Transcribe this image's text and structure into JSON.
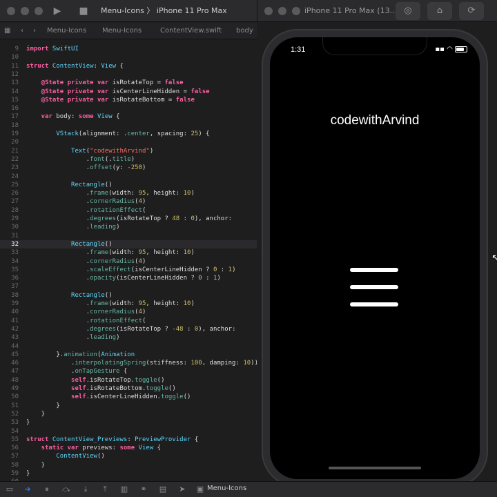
{
  "xcode_toolbar": {
    "scheme_target": "Menu-Icons",
    "scheme_device": "iPhone 11 Pro Max",
    "run_icon": "play-icon",
    "stop_icon": "stop-icon"
  },
  "simulator_toolbar": {
    "title": "iPhone 11 Pro Max (13....",
    "tools": [
      "screenshot-icon",
      "home-icon",
      "rotate-icon"
    ]
  },
  "jumpbar": {
    "crumbs": [
      "Menu-Icons",
      "Menu-Icons",
      "ContentView.swift",
      "body"
    ]
  },
  "editor": {
    "current_line": 32,
    "lines": [
      {
        "n": 9
      },
      {
        "n": 10
      },
      {
        "n": 11
      },
      {
        "n": 12
      },
      {
        "n": 13
      },
      {
        "n": 14
      },
      {
        "n": 15
      },
      {
        "n": 16
      },
      {
        "n": 17
      },
      {
        "n": 18
      },
      {
        "n": 19
      },
      {
        "n": 20
      },
      {
        "n": 21
      },
      {
        "n": 22
      },
      {
        "n": 23
      },
      {
        "n": 24
      },
      {
        "n": 25
      },
      {
        "n": 26
      },
      {
        "n": 27
      },
      {
        "n": 28
      },
      {
        "n": 29
      },
      {
        "n": 30
      },
      {
        "n": 31
      },
      {
        "n": 32
      },
      {
        "n": 33
      },
      {
        "n": 34
      },
      {
        "n": 35
      },
      {
        "n": 36
      },
      {
        "n": 37
      },
      {
        "n": 38
      },
      {
        "n": 39
      },
      {
        "n": 40
      },
      {
        "n": 41
      },
      {
        "n": 42
      },
      {
        "n": 43
      },
      {
        "n": 44
      },
      {
        "n": 45
      },
      {
        "n": 46
      },
      {
        "n": 47
      },
      {
        "n": 48
      },
      {
        "n": 49
      },
      {
        "n": 50
      },
      {
        "n": 51
      },
      {
        "n": 52
      },
      {
        "n": 53
      },
      {
        "n": 54
      },
      {
        "n": 55
      },
      {
        "n": 56
      },
      {
        "n": 57
      },
      {
        "n": 58
      },
      {
        "n": 59
      },
      {
        "n": 60
      }
    ],
    "code": {
      "l9_kw": "import",
      "l9_ty": " SwiftUI",
      "l11_kw": "struct",
      "l11_ty": " ContentView",
      "l11_pl": ": ",
      "l11_ty2": "View",
      "l11_pl2": " {",
      "l13_kw": "    @State private var",
      "l13_pl": " isRotateTop = ",
      "l13_kw2": "false",
      "l14_kw": "    @State private var",
      "l14_pl": " isCenterLineHidden = ",
      "l14_kw2": "false",
      "l15_kw": "    @State private var",
      "l15_pl": " isRotateBottom = ",
      "l15_kw2": "false",
      "l17_kw": "    var",
      "l17_pl": " body: ",
      "l17_kw2": "some",
      "l17_ty": " View",
      "l17_pl2": " {",
      "l19_ty": "        VStack",
      "l19_pl": "(alignment: .",
      "l19_fn": "center",
      "l19_pl2": ", spacing: ",
      "l19_nu": "25",
      "l19_pl3": ") {",
      "l21_ty": "            Text",
      "l21_pl": "(",
      "l21_st": "\"codewithArvind\"",
      "l21_pl2": ")",
      "l22_pl": "                .",
      "l22_fn": "font",
      "l22_pl2": "(.",
      "l22_fn2": "title",
      "l22_pl3": ")",
      "l23_pl": "                .",
      "l23_fn": "offset",
      "l23_pl2": "(y: ",
      "l23_nu": "-250",
      "l23_pl3": ")",
      "l25_ty": "            Rectangle",
      "l25_pl": "()",
      "l26_pl": "                .",
      "l26_fn": "frame",
      "l26_pl2": "(width: ",
      "l26_nu": "95",
      "l26_pl3": ", height: ",
      "l26_nu2": "10",
      "l26_pl4": ")",
      "l27_pl": "                .",
      "l27_fn": "cornerRadius",
      "l27_pl2": "(",
      "l27_nu": "4",
      "l27_pl3": ")",
      "l28_pl": "                .",
      "l28_fn": "rotationEffect",
      "l28_pl2": "(",
      "l29_pl": "                .",
      "l29_fn": "degrees",
      "l29_pl2": "(isRotateTop ? ",
      "l29_nu": "48",
      "l29_pl3": " : ",
      "l29_nu2": "0",
      "l29_pl4": "), anchor:",
      "l30_pl": "                .",
      "l30_fn": "leading",
      "l30_pl2": ")",
      "l32_ty": "            Rectangle",
      "l32_pl": "()",
      "l33_pl": "                .",
      "l33_fn": "frame",
      "l33_pl2": "(width: ",
      "l33_nu": "95",
      "l33_pl3": ", height: ",
      "l33_nu2": "10",
      "l33_pl4": ")",
      "l34_pl": "                .",
      "l34_fn": "cornerRadius",
      "l34_pl2": "(",
      "l34_nu": "4",
      "l34_pl3": ")",
      "l35_pl": "                .",
      "l35_fn": "scaleEffect",
      "l35_pl2": "(isCenterLineHidden ? ",
      "l35_nu": "0",
      "l35_pl3": " : ",
      "l35_nu2": "1",
      "l35_pl4": ")",
      "l36_pl": "                .",
      "l36_fn": "opacity",
      "l36_pl2": "(isCenterLineHidden ? ",
      "l36_nu": "0",
      "l36_pl3": " : ",
      "l36_nu2": "1",
      "l36_pl4": ")",
      "l38_ty": "            Rectangle",
      "l38_pl": "()",
      "l39_pl": "                .",
      "l39_fn": "frame",
      "l39_pl2": "(width: ",
      "l39_nu": "95",
      "l39_pl3": ", height: ",
      "l39_nu2": "10",
      "l39_pl4": ")",
      "l40_pl": "                .",
      "l40_fn": "cornerRadius",
      "l40_pl2": "(",
      "l40_nu": "4",
      "l40_pl3": ")",
      "l41_pl": "                .",
      "l41_fn": "rotationEffect",
      "l41_pl2": "(",
      "l42_pl": "                .",
      "l42_fn": "degrees",
      "l42_pl2": "(isRotateTop ? ",
      "l42_nu": "-48",
      "l42_pl3": " : ",
      "l42_nu2": "0",
      "l42_pl4": "), anchor:",
      "l43_pl": "                .",
      "l43_fn": "leading",
      "l43_pl2": ")",
      "l45_pl": "        }.",
      "l45_fn": "animation",
      "l45_pl2": "(",
      "l45_ty": "Animation",
      "l46_pl": "            .",
      "l46_fn": "interpolatingSpring",
      "l46_pl2": "(stiffness: ",
      "l46_nu": "100",
      "l46_pl3": ", damping: ",
      "l46_nu2": "10",
      "l46_pl4": "))",
      "l47_pl": "            .",
      "l47_fn": "onTapGesture",
      "l47_pl2": " {",
      "l48_kw": "            self",
      "l48_pl": ".isRotateTop.",
      "l48_fn": "toggle",
      "l48_pl2": "()",
      "l49_kw": "            self",
      "l49_pl": ".isRotateBottom.",
      "l49_fn": "toggle",
      "l49_pl2": "()",
      "l50_kw": "            self",
      "l50_pl": ".isCenterLineHidden.",
      "l50_fn": "toggle",
      "l50_pl2": "()",
      "l51_pl": "        }",
      "l52_pl": "    }",
      "l53_pl": "}",
      "l55_kw": "struct",
      "l55_ty": " ContentView_Previews",
      "l55_pl": ": ",
      "l55_ty2": "PreviewProvider",
      "l55_pl2": " {",
      "l56_kw": "    static var",
      "l56_pl": " previews: ",
      "l56_kw2": "some",
      "l56_ty": " View",
      "l56_pl2": " {",
      "l57_ty": "        ContentView",
      "l57_pl": "()",
      "l58_pl": "    }",
      "l59_pl": "}"
    }
  },
  "simulator": {
    "status_time": "1:31",
    "app_title": "codewithArvind",
    "menu_icon_bars": 3
  },
  "bottombar": {
    "scheme_label": "Menu-Icons"
  },
  "colors": {
    "keyword": "#fc5fa3",
    "type": "#5dd8ff",
    "function": "#67b7a4",
    "string": "#fc6a5d",
    "number": "#d0bf69"
  }
}
